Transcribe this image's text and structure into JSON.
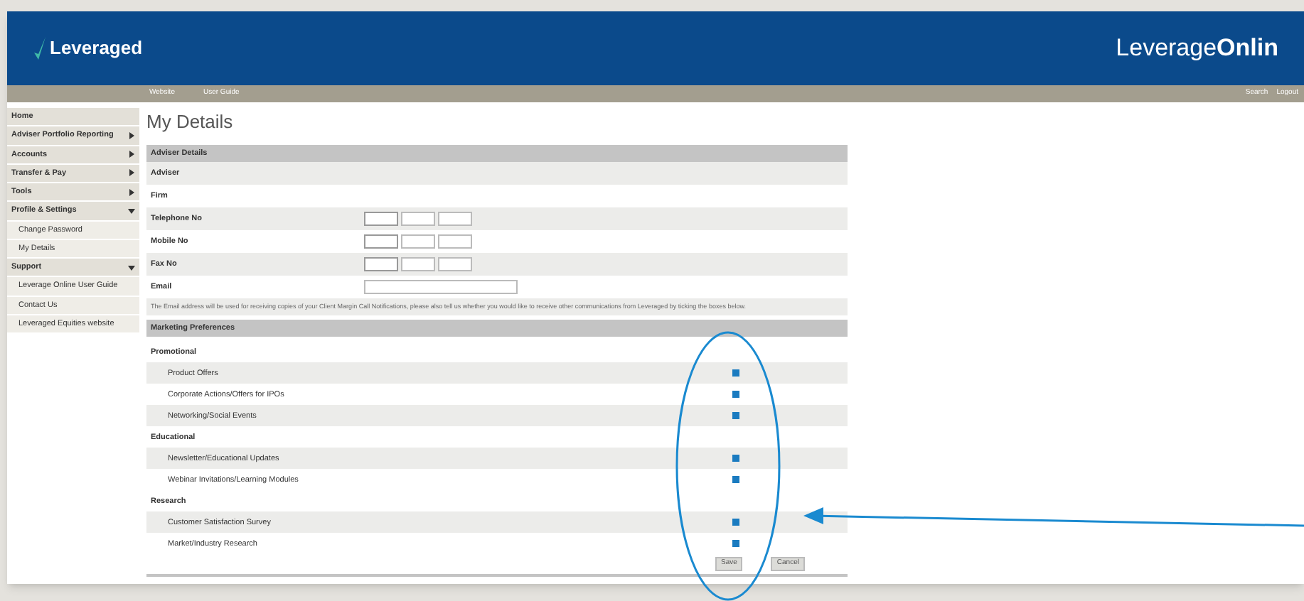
{
  "header": {
    "logo": "Leveraged",
    "brand": "Leverage**Onlin**"
  },
  "nav_bar": {
    "links": [
      "Website",
      "User Guide"
    ],
    "right_links": [
      "Search",
      "Logout"
    ]
  },
  "sidebar": {
    "items": [
      {
        "label": "Home",
        "kind": "section"
      },
      {
        "label": "Adviser Portfolio Reporting",
        "kind": "menu",
        "expanded": false
      },
      {
        "label": "Accounts",
        "kind": "menu",
        "expanded": false
      },
      {
        "label": "Transfer & Pay",
        "kind": "menu",
        "expanded": false
      },
      {
        "label": "Tools",
        "kind": "menu",
        "expanded": false
      },
      {
        "label": "Profile & Settings",
        "kind": "menu",
        "expanded": true,
        "children": [
          {
            "label": "Change Password"
          },
          {
            "label": "My Details"
          }
        ]
      },
      {
        "label": "Support",
        "kind": "menu",
        "expanded": true,
        "children": [
          {
            "label": "Leverage Online User Guide"
          },
          {
            "label": "Contact Us"
          },
          {
            "label": "Leveraged Equities website"
          }
        ]
      }
    ]
  },
  "page_title": "My Details",
  "adviser_details": {
    "heading": "Adviser Details",
    "fields": [
      {
        "label": "Adviser",
        "kind": "text"
      },
      {
        "label": "Firm",
        "kind": "text"
      },
      {
        "label": "Telephone No",
        "kind": "phone"
      },
      {
        "label": "Mobile No",
        "kind": "phone"
      },
      {
        "label": "Fax No",
        "kind": "phone"
      },
      {
        "label": "Email",
        "kind": "email"
      }
    ],
    "notice": "The Email address will be used for receiving copies of your Client Margin Call Notifications, please also tell us whether you would like to receive other communications from Leveraged by ticking the boxes below."
  },
  "marketing_preferences": {
    "heading": "Marketing Preferences",
    "groups": [
      {
        "label": "Promotional",
        "options": [
          {
            "label": "Product Offers",
            "checked": true
          },
          {
            "label": "Corporate Actions/Offers for IPOs",
            "checked": true
          },
          {
            "label": "Networking/Social Events",
            "checked": true
          }
        ]
      },
      {
        "label": "Educational",
        "options": [
          {
            "label": "Newsletter/Educational Updates",
            "checked": true
          },
          {
            "label": "Webinar Invitations/Learning Modules",
            "checked": true
          }
        ]
      },
      {
        "label": "Research",
        "options": [
          {
            "label": "Customer Satisfaction Survey",
            "checked": true
          },
          {
            "label": "Market/Industry Research",
            "checked": true
          }
        ]
      }
    ]
  },
  "buttons": [
    "Save",
    "Cancel"
  ]
}
